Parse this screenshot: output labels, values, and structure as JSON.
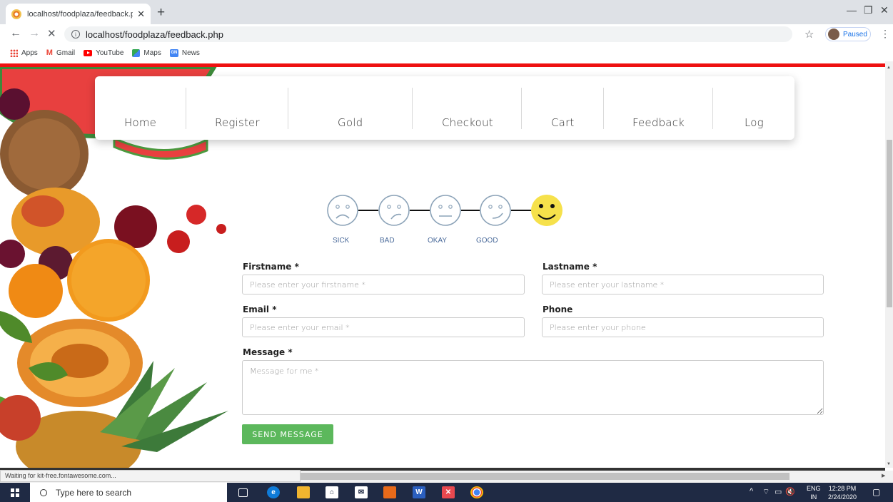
{
  "browser": {
    "tab_title": "localhost/foodplaza/feedback.ph",
    "url": "localhost/foodplaza/feedback.php",
    "profile_status": "Paused",
    "bookmarks": [
      {
        "label": "Apps",
        "icon": "apps-grid-icon"
      },
      {
        "label": "Gmail",
        "icon": "gmail-icon"
      },
      {
        "label": "YouTube",
        "icon": "youtube-icon"
      },
      {
        "label": "Maps",
        "icon": "maps-icon"
      },
      {
        "label": "News",
        "icon": "news-icon"
      }
    ],
    "status_text": "Waiting for kit-free.fontawesome.com..."
  },
  "nav": {
    "items": [
      "Home",
      "Register",
      "Gold",
      "Checkout",
      "Cart",
      "Feedback",
      "Log"
    ]
  },
  "rating": {
    "labels": [
      "SICK",
      "BAD",
      "OKAY",
      "GOOD"
    ],
    "selected_index": 4,
    "colors": {
      "outline": "#8ca3b8",
      "selected_fill": "#f6e14b",
      "connector": "#111111"
    }
  },
  "form": {
    "firstname_label": "Firstname *",
    "firstname_placeholder": "Please enter your firstname *",
    "lastname_label": "Lastname *",
    "lastname_placeholder": "Please enter your lastname *",
    "email_label": "Email *",
    "email_placeholder": "Please enter your email *",
    "phone_label": "Phone",
    "phone_placeholder": "Please enter your phone",
    "message_label": "Message *",
    "message_placeholder": "Message for me *",
    "submit_label": "SEND MESSAGE",
    "submit_color": "#5cb85c"
  },
  "taskbar": {
    "search_placeholder": "Type here to search",
    "lang_line1": "ENG",
    "lang_line2": "IN",
    "time": "12:28 PM",
    "date": "2/24/2020"
  },
  "colors": {
    "accent_red": "#ee1111",
    "taskbar": "#1f2a44"
  }
}
